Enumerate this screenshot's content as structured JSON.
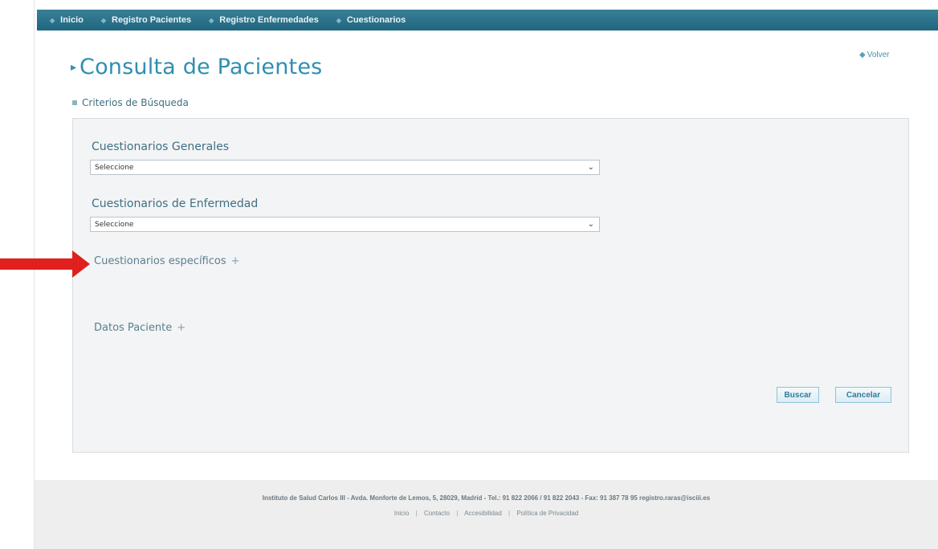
{
  "nav": {
    "items": [
      "Inicio",
      "Registro Pacientes",
      "Registro Enfermedades",
      "Cuestionarios"
    ]
  },
  "volver_label": "Volver",
  "page_title": "Consulta de Pacientes",
  "section_title": "Criterios de Búsqueda",
  "form": {
    "generales": {
      "label": "Cuestionarios Generales",
      "value": "Seleccione"
    },
    "enfermedad": {
      "label": "Cuestionarios de Enfermedad",
      "value": "Seleccione"
    },
    "especificos_label": "Cuestionarios específicos",
    "datos_label": "Datos Paciente",
    "expand_symbol": "+"
  },
  "buttons": {
    "buscar": "Buscar",
    "cancelar": "Cancelar"
  },
  "footer": {
    "address": "Instituto de Salud Carlos III - Avda. Monforte de Lemos, 5, 28029, Madrid - Tel.: 91 822 2066 / 91 822 2043 - Fax: 91 387 78 95 registro.raras@isciii.es",
    "links": [
      "Inicio",
      "Contacto",
      "Accesibilidad",
      "Política de Privacidad"
    ]
  },
  "colors": {
    "accent": "#2f8fb0",
    "nav_bar": "#1f6680",
    "annotation_arrow": "#e0201c"
  }
}
